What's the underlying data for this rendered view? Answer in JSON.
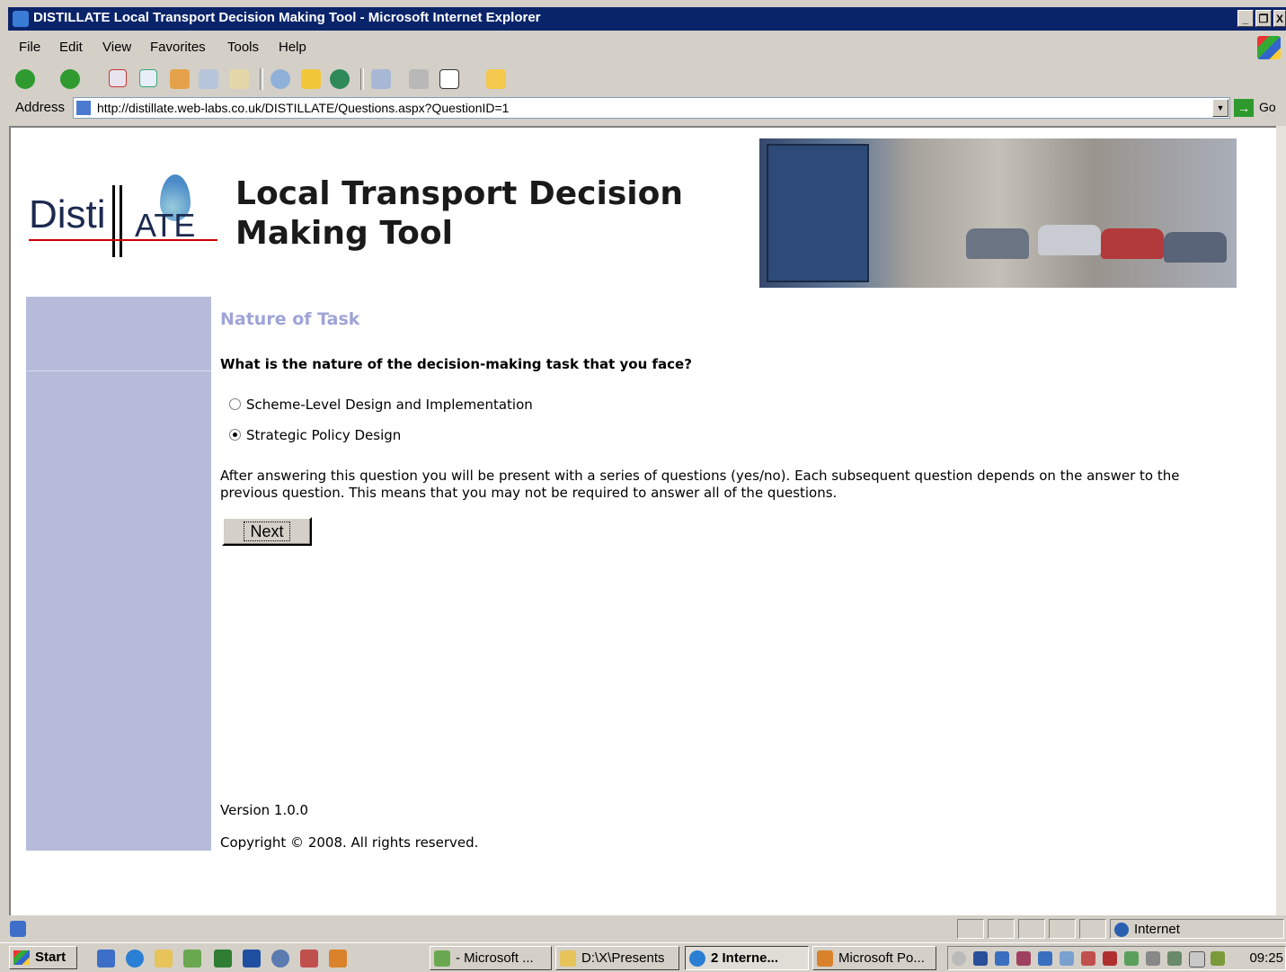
{
  "window": {
    "title": "DISTILLATE Local Transport Decision Making Tool - Microsoft Internet Explorer",
    "buttons": [
      "_",
      "❐",
      "X"
    ]
  },
  "menu": {
    "items": [
      "File",
      "Edit",
      "View",
      "Favorites",
      "Tools",
      "Help"
    ]
  },
  "toolbar": {
    "icons": [
      "back-icon",
      "forward-icon",
      "stop-icon",
      "refresh-icon",
      "home-icon",
      "copy-icon",
      "paste-icon",
      "search-icon",
      "favorites-icon",
      "history-icon",
      "mail-icon",
      "print-icon",
      "word-icon",
      "folder-icon"
    ]
  },
  "address": {
    "label": "Address",
    "url": "http://distillate.web-labs.co.uk/DISTILLATE/Questions.aspx?QuestionID=1",
    "go_label": "Go"
  },
  "page": {
    "logo_text_left": "Disti",
    "logo_text_right": "ATE",
    "site_title_line1": "Local Transport Decision",
    "site_title_line2": "Making Tool",
    "section_heading": "Nature of Task",
    "question": "What is the nature of the decision-making task that you face?",
    "options": [
      {
        "label": "Scheme-Level Design and Implementation",
        "selected": false
      },
      {
        "label": "Strategic Policy Design",
        "selected": true
      }
    ],
    "info": "After answering this question you will be present with a series of questions (yes/no). Each subsequent question depends on the answer to the previous question. This means that you may not be required to answer all of the questions.",
    "next_label": "Next",
    "version": "Version 1.0.0",
    "copyright": "Copyright © 2008. All rights reserved."
  },
  "statusbar": {
    "zone": "Internet"
  },
  "taskbar": {
    "start_label": "Start",
    "tasks": [
      {
        "label": "- Microsoft ...",
        "active": false
      },
      {
        "label": "D:\\X\\Presents",
        "active": false
      },
      {
        "label": "2 Interne...",
        "active": true
      },
      {
        "label": "Microsoft Po...",
        "active": false
      }
    ],
    "clock": "09:25"
  },
  "colors": {
    "sidebar": "#b6bbda",
    "heading": "#9ea4d6",
    "titlebar": "#0a246a"
  }
}
